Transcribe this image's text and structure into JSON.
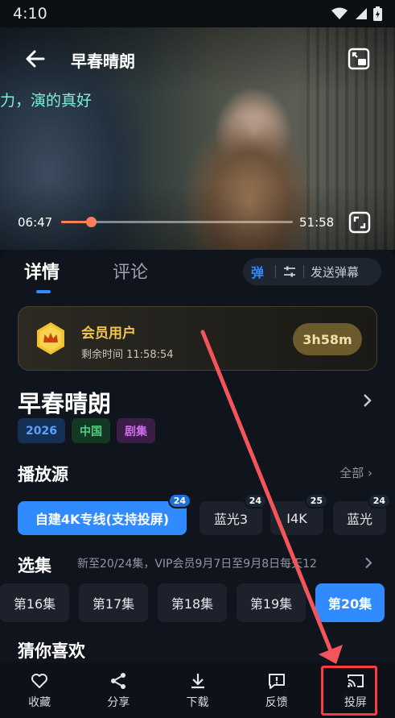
{
  "status_bar": {
    "time": "4:10"
  },
  "video": {
    "title": "早春晴朗",
    "danmaku_text": "力，演的真好",
    "current_time": "06:47",
    "total_time": "51:58",
    "progress": 0.13
  },
  "tabs": {
    "detail": "详情",
    "comment": "评论"
  },
  "danmaku_controls": {
    "toggle_label": "弹",
    "send_label": "发送弹幕"
  },
  "vip": {
    "title": "会员用户",
    "remaining": "剩余时间 11:58:54",
    "timer": "3h58m"
  },
  "show": {
    "title": "早春晴朗",
    "tags": {
      "year": "2026",
      "region": "中国",
      "type": "剧集"
    }
  },
  "sources": {
    "title": "播放源",
    "more": "全部",
    "items": [
      {
        "label": "自建4K专线(支持投屏)",
        "count": "24"
      },
      {
        "label": "蓝光3",
        "count": "24"
      },
      {
        "label": "I4K",
        "count": "25"
      },
      {
        "label": "蓝光",
        "count": "24"
      }
    ]
  },
  "episodes": {
    "title": "选集",
    "note": "新至20/24集，VIP会员9月7日至9月8日每天12",
    "items": [
      "第16集",
      "第17集",
      "第18集",
      "第19集",
      "第20集"
    ]
  },
  "recommend": {
    "title": "猜你喜欢"
  },
  "bottom_bar": {
    "favorite": "收藏",
    "share": "分享",
    "download": "下载",
    "feedback": "反馈",
    "cast": "投屏"
  },
  "colors": {
    "accent": "#2f8bff",
    "vip_gold": "#f3c451",
    "annotation_red": "#ff3b3b"
  }
}
